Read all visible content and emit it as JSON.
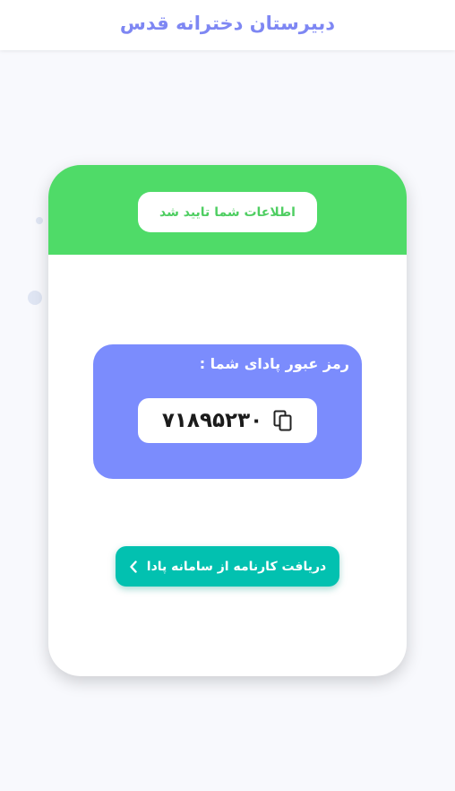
{
  "header": {
    "title": "دبیرستان دخترانه قدس"
  },
  "card": {
    "status_message": "اطلاعات شما تایید شد",
    "password_label": "رمز عبور پادای شما :",
    "password_value": "۷۱۸۹۵۲۳۰",
    "copy_icon": "copy-icon",
    "report_button_label": "دریافت کارنامه از سامانه پادا",
    "report_button_icon": "chevron-left-icon"
  },
  "colors": {
    "header_title": "#7e87f3",
    "success_green": "#4fdb68",
    "password_box": "#7b8cfd",
    "button_teal": "#02c1b0"
  }
}
